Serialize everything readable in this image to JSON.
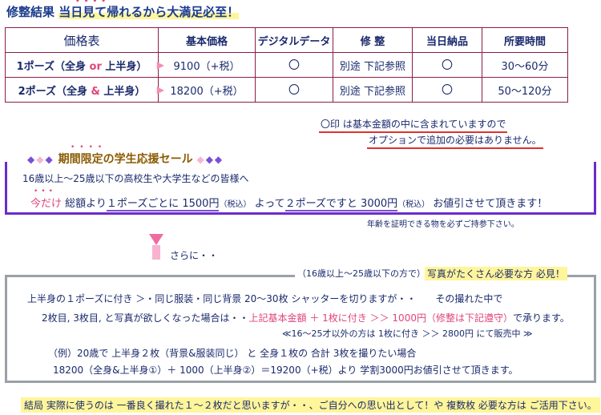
{
  "header": {
    "title_prefix": "修整結果 ",
    "title_highlight": "当日見て帰れるから大満足必至！",
    "emphasis_dots": "••••"
  },
  "price_table": {
    "headers": [
      "価格表",
      "基本価格",
      "デジタルデータ",
      "修 整",
      "当日納品",
      "所要時間"
    ],
    "rows": [
      {
        "label_a": "1ポーズ（全身 ",
        "connector": "or",
        "label_b": " 上半身）",
        "price": "9100（+税）",
        "digital": "〇",
        "retouch": "別途 下記参照",
        "same_day": "〇",
        "time": "30〜60分"
      },
      {
        "label_a": "2ポーズ（全身 ",
        "connector": "&",
        "label_b": " 上半身）",
        "price": "18200（+税）",
        "digital": "〇",
        "retouch": "別途 下記参照",
        "same_day": "〇",
        "time": "50〜120分"
      }
    ],
    "arrow_glyph": "▶"
  },
  "notes": {
    "line1": "〇印 は基本金額の中に含まれていますので",
    "line2": "オプションで追加の必要はありません。"
  },
  "student_sale": {
    "title": "期間限定の学生応援セール",
    "title_dots": "••••",
    "eligibility": "16歳以上〜25歳以下の高校生や大学生などの皆様へ",
    "today_dots": "•••",
    "offer_today": "今だけ",
    "offer_part1": " 総額より",
    "offer_per_pose": "１ポーズごとに 1500円",
    "offer_tax1": "（税込）",
    "offer_part2": " よって",
    "offer_two_pose": "２ポーズですと 3000円",
    "offer_tax2": "（税込）",
    "offer_part3": " お値引させて頂きます！",
    "id_note": "年齢を証明できる物を必ずご持参下さい。"
  },
  "continuation": {
    "label": "さらに・・"
  },
  "multi_photo": {
    "age_note": "（16歳以上〜25歳以下の方で）",
    "heading": "写真がたくさん必要な方 必見！",
    "line1": "上半身の１ポーズに付き ＞・同じ服装・同じ背景 20〜30枚 シャッターを切りますが・・　　その撮れた中で",
    "line2_a": "2枚目, 3枚目, と写真が欲しくなった場合は・・",
    "line2_b": "上記基本金額 ＋ 1枚に付き ＞＞ 1000円（修整は下記遵守）",
    "line2_c": "で承ります。",
    "line3": "≪16〜25才以外の方は 1枚に付き ＞＞ 2800円 にて販売中 ≫",
    "line4": "（例）20歳で 上半身２枚（背景&服装同じ） と 全身１枚の 合計 3枚を撮りたい場合",
    "line5": "18200（全身&上半身①）＋ 1000（上半身②）＝19200（+税）より 学割3000円お値引させて頂きます。"
  },
  "footer": {
    "text": "結局 実際に使うのは 一番良く撮れた１〜２枚だと思いますが・・、ご自分への思い出として！や 複数枚 必要な方は ご活用下さい。"
  },
  "colors": {
    "table_border": "#8b1d4a",
    "sale_border": "#6a2ccc",
    "accent_pink": "#e0457b",
    "highlight_yellow": "#fff59a",
    "text_navy": "#1a2a6c"
  }
}
